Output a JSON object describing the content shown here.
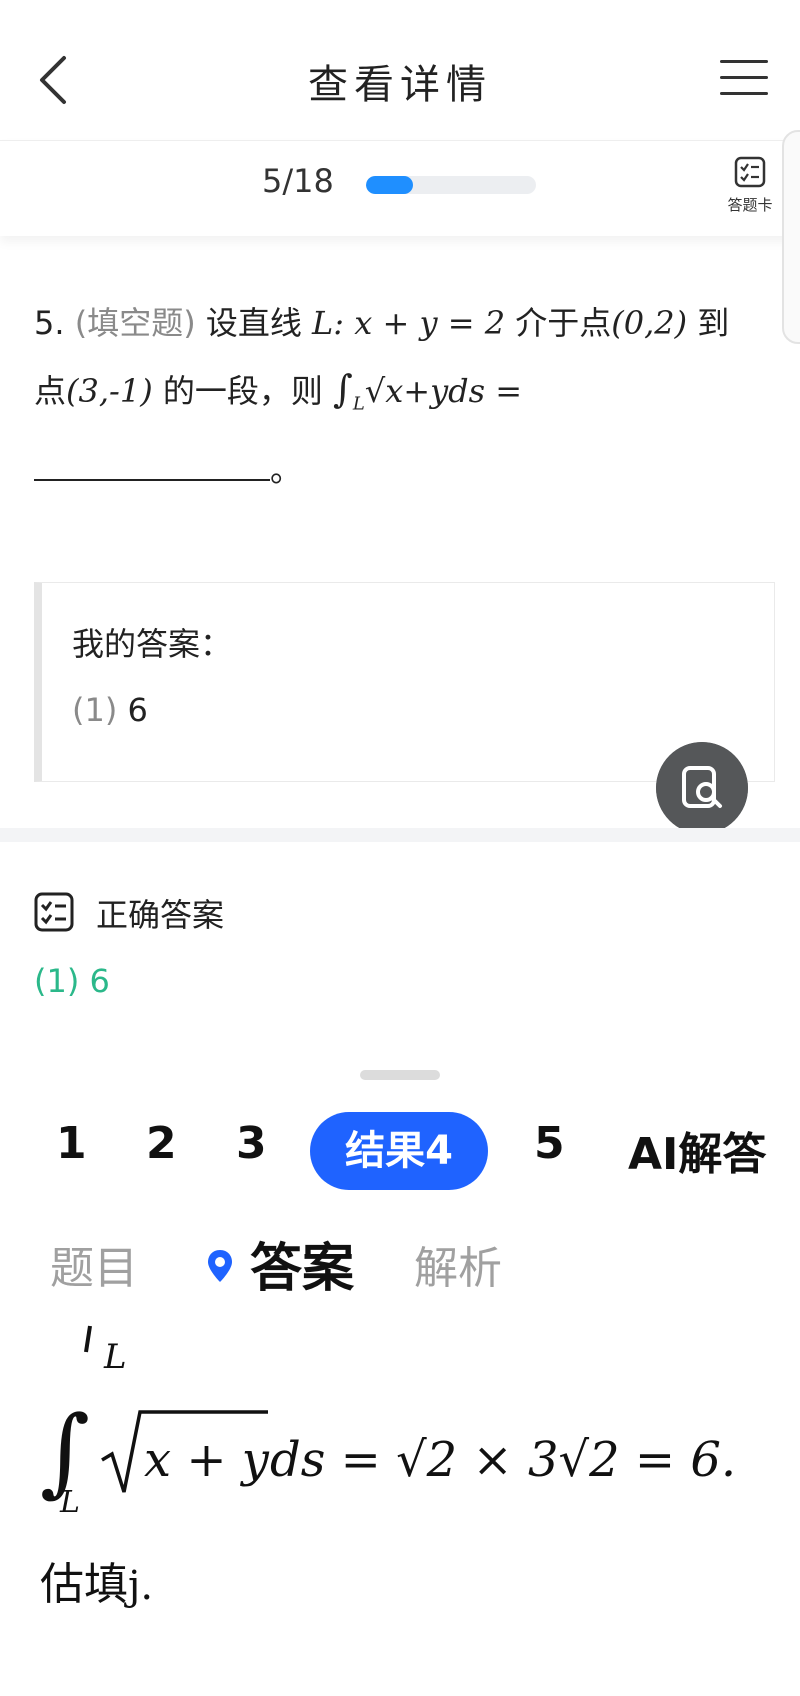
{
  "header": {
    "title": "查看详情"
  },
  "progress": {
    "text": "5/18",
    "fraction": 0.277,
    "accent": "#1f8fff"
  },
  "answer_card": {
    "label": "答题卡"
  },
  "question": {
    "number": "5.",
    "type": "(填空题)",
    "text_1": "设直线",
    "math_line": "L: x + y = 2",
    "text_2": "介于点",
    "point_1": "(0,2)",
    "text_3": "到",
    "text_4": "点",
    "point_2": "(3,-1)",
    "text_5": "的一段，则",
    "integral": "∫",
    "integral_sub": "L",
    "integrand": "√x+yds =",
    "end_punct": "。"
  },
  "my_answer": {
    "heading": "我的答案：",
    "index": "(1)",
    "value": "6"
  },
  "correct_answer": {
    "heading": "正确答案",
    "value": "(1) 6",
    "color": "#2bb88a"
  },
  "tabs": {
    "t1": "1",
    "t2": "2",
    "t3": "3",
    "active": "结果4",
    "t5": "5",
    "ai": "AI解答",
    "active_color": "#1f63ff"
  },
  "subtabs": {
    "question": "题目",
    "answer": "答案",
    "analysis": "解析"
  },
  "formula": {
    "frag_sub": "L",
    "lhs_sub": "L",
    "lhs": "∫",
    "radicand": "x + y",
    "tail": "ds = √2 × 3√2 = 6."
  },
  "footer": {
    "text": "估填",
    "tail": "j."
  }
}
